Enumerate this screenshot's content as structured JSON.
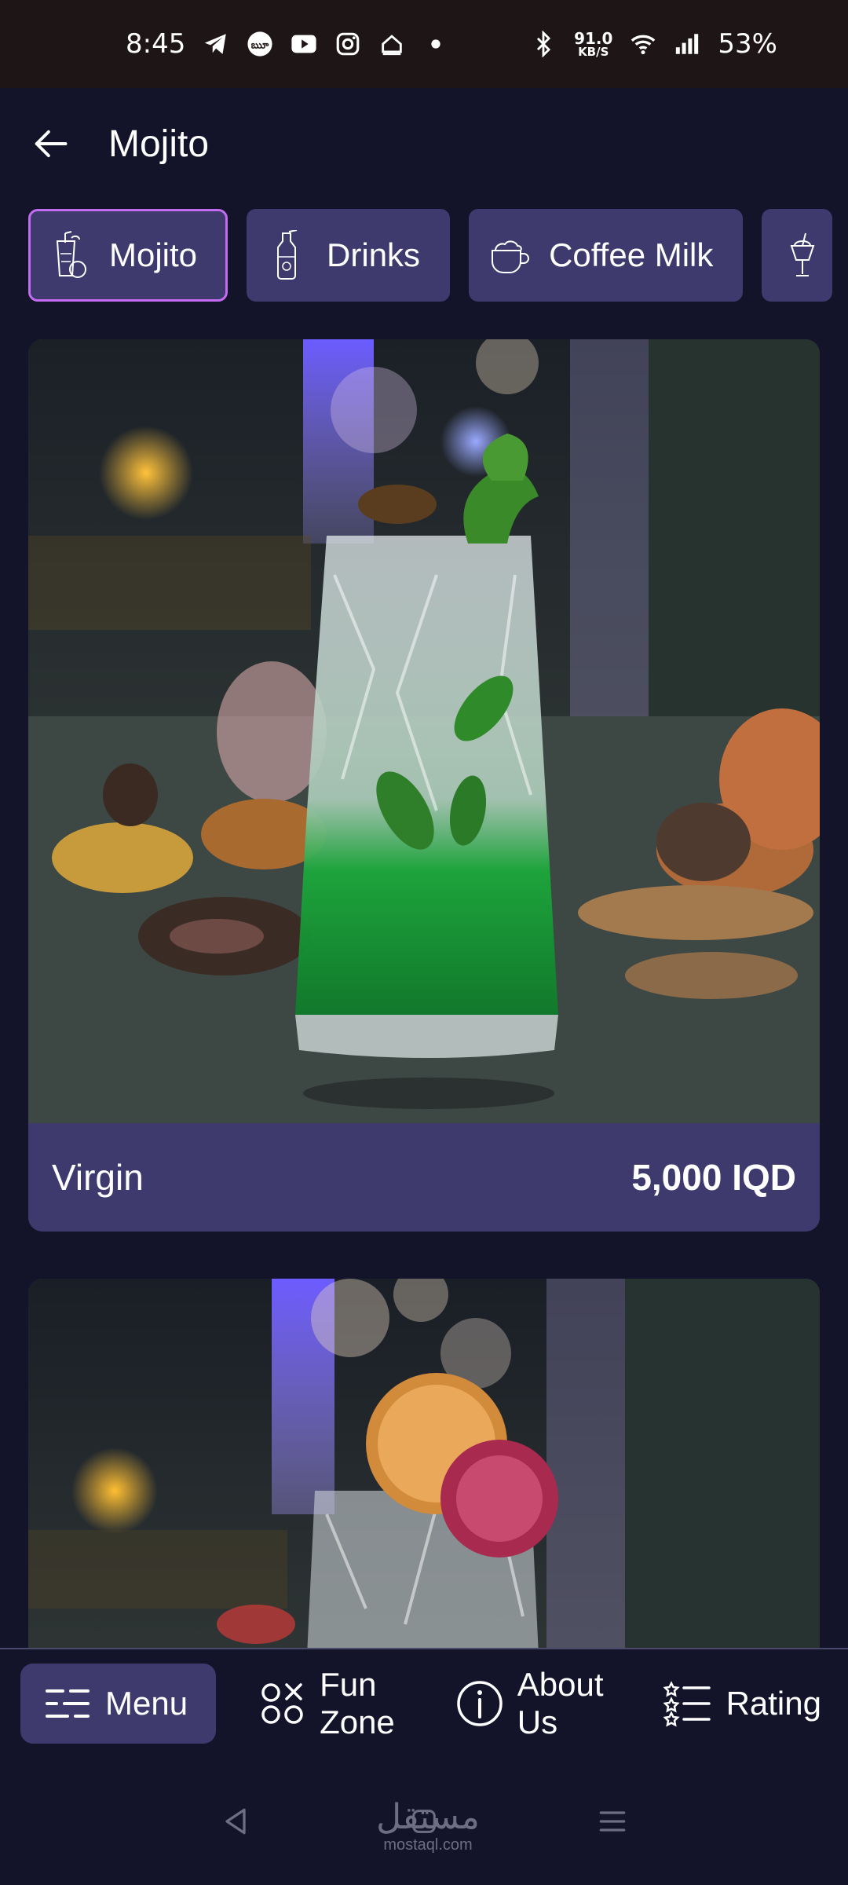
{
  "status_bar": {
    "time": "8:45",
    "net_speed": "91.0",
    "net_unit": "KB/S",
    "battery": "53%",
    "left_icons": [
      "telegram-icon",
      "app-badge-icon",
      "youtube-icon",
      "instagram-icon",
      "home-outline-icon",
      "dot-icon"
    ],
    "right_icons": [
      "bluetooth-icon",
      "wifi-icon",
      "signal-icon"
    ]
  },
  "app_bar": {
    "title": "Mojito"
  },
  "categories": [
    {
      "label": "Mojito",
      "icon": "mojito-glass-icon",
      "active": true
    },
    {
      "label": "Drinks",
      "icon": "bottle-icon",
      "active": false
    },
    {
      "label": "Coffee Milk",
      "icon": "coffee-cup-icon",
      "active": false
    },
    {
      "label": "",
      "icon": "milkshake-icon",
      "active": false
    }
  ],
  "products": [
    {
      "name": "Virgin",
      "price": "5,000 IQD",
      "image": "green-mojito-photo"
    },
    {
      "name": "",
      "price": "",
      "image": "citrus-mojito-photo"
    }
  ],
  "bottom_nav": [
    {
      "label": "Menu",
      "icon": "menu-icon",
      "active": true
    },
    {
      "label": "Fun Zone",
      "icon": "fun-zone-icon",
      "active": false
    },
    {
      "label": "About Us",
      "icon": "info-icon",
      "active": false
    },
    {
      "label": "Rating",
      "icon": "rating-list-icon",
      "active": false
    }
  ],
  "watermark": {
    "arabic": "مستقل",
    "latin": "mostaql.com"
  },
  "colors": {
    "background": "#13142a",
    "chip_bg": "#3e3a6e",
    "active_border": "#c36cf2",
    "status_bar_bg": "#1e1516"
  }
}
